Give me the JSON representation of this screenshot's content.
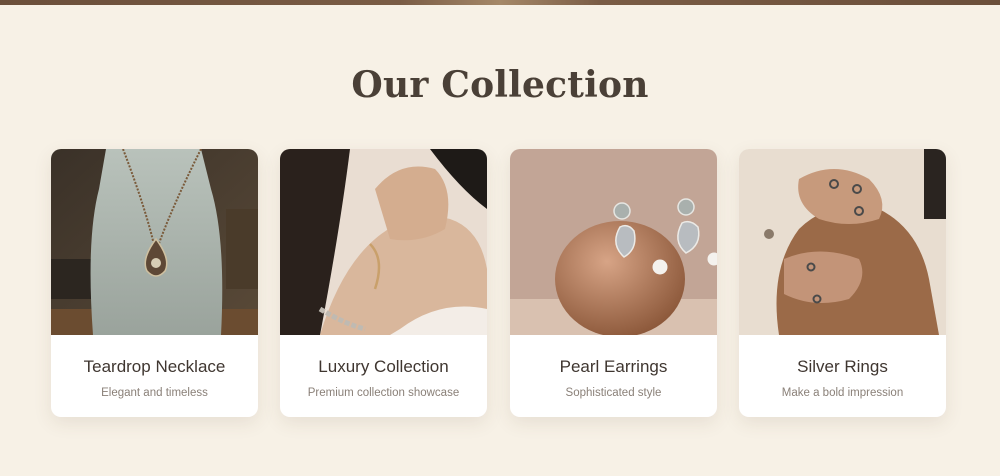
{
  "section": {
    "title": "Our Collection"
  },
  "cards": [
    {
      "title": "Teardrop Necklace",
      "description": "Elegant and timeless",
      "image_icon": "necklace-photo"
    },
    {
      "title": "Luxury Collection",
      "description": "Premium collection showcase",
      "image_icon": "bracelet-photo"
    },
    {
      "title": "Pearl Earrings",
      "description": "Sophisticated style",
      "image_icon": "earrings-photo"
    },
    {
      "title": "Silver Rings",
      "description": "Make a bold impression",
      "image_icon": "rings-photo"
    }
  ],
  "colors": {
    "background": "#f7f1e6",
    "title": "#4a4037",
    "card": "#ffffff",
    "card_title": "#3f3630",
    "card_desc": "#8a8078"
  }
}
